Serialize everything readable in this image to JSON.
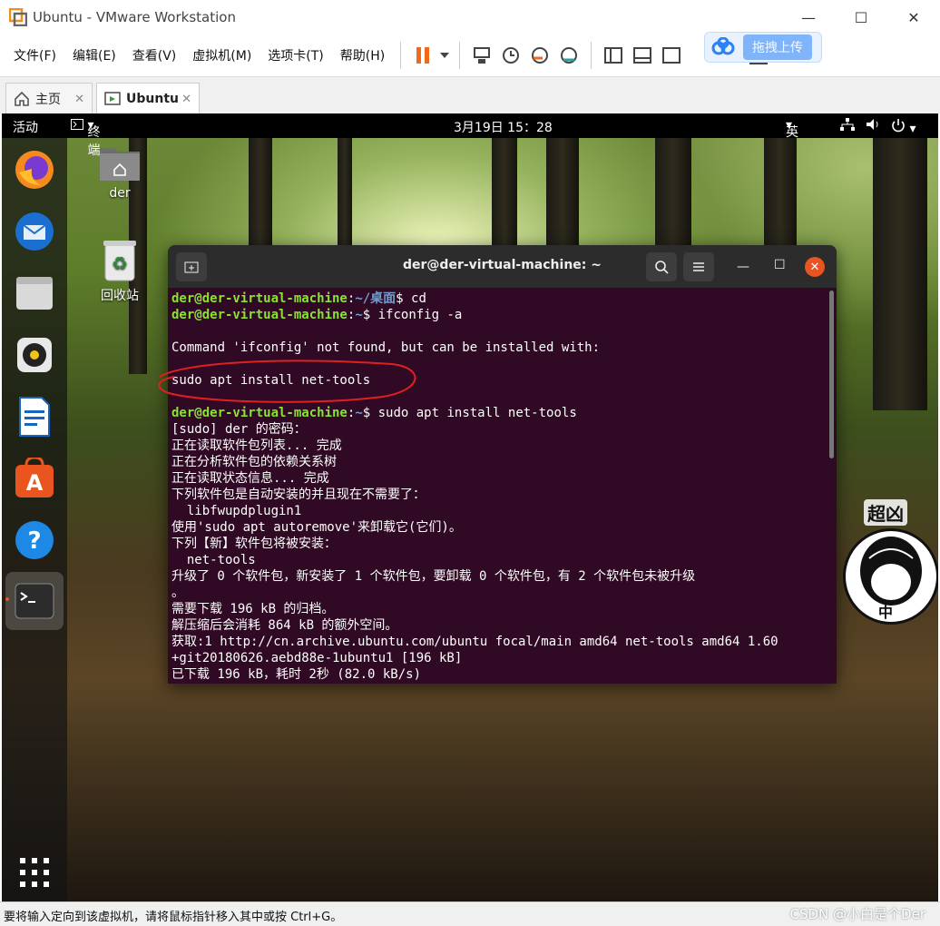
{
  "window": {
    "title": "Ubuntu - VMware Workstation"
  },
  "menu": [
    "文件(F)",
    "编辑(E)",
    "查看(V)",
    "虚拟机(M)",
    "选项卡(T)",
    "帮助(H)"
  ],
  "baidu_float": {
    "label": "拖拽上传"
  },
  "tabs": [
    {
      "label": "主页",
      "active": false
    },
    {
      "label": "Ubuntu",
      "active": true
    }
  ],
  "ubuntu_topbar": {
    "activities": "活动",
    "app_menu": "终端",
    "clock": "3月19日 15：28",
    "input_method": "英"
  },
  "desktop_icons": [
    {
      "label": "der"
    },
    {
      "label": "回收站"
    }
  ],
  "terminal": {
    "title": "der@der-virtual-machine: ~",
    "prompt_user": "der@der-virtual-machine",
    "lines": {
      "l1_path": "~/桌面",
      "l1_cmd": "$ cd",
      "l2_path": "~",
      "l2_cmd": "$ ifconfig -a",
      "l3": "",
      "l4": "Command 'ifconfig' not found, but can be installed with:",
      "l5": "",
      "l6": "sudo apt install net-tools",
      "l7": "",
      "l8_path": "~",
      "l8_cmd": "$ sudo apt install net-tools",
      "l9": "[sudo] der 的密码：",
      "l10": "正在读取软件包列表... 完成",
      "l11": "正在分析软件包的依赖关系树",
      "l12": "正在读取状态信息... 完成",
      "l13": "下列软件包是自动安装的并且现在不需要了：",
      "l14": "  libfwupdplugin1",
      "l15": "使用'sudo apt autoremove'来卸载它(它们)。",
      "l16": "下列【新】软件包将被安装：",
      "l17": "  net-tools",
      "l18": "升级了 0 个软件包，新安装了 1 个软件包，要卸载 0 个软件包，有 2 个软件包未被升级",
      "l19": "。",
      "l20": "需要下载 196 kB 的归档。",
      "l21": "解压缩后会消耗 864 kB 的额外空间。",
      "l22": "获取:1 http://cn.archive.ubuntu.com/ubuntu focal/main amd64 net-tools amd64 1.60",
      "l23": "+git20180626.aebd88e-1ubuntu1 [196 kB]",
      "l24": "已下载 196 kB，耗时 2秒 (82.0 kB/s)"
    }
  },
  "avatar_caption": "超凶",
  "avatar_text": "中",
  "statusbar": {
    "message": "要将输入定向到该虚拟机，请将鼠标指针移入其中或按 Ctrl+G。"
  },
  "watermark": "CSDN @小白是个Der",
  "colors": {
    "terminal_bg": "#300a24",
    "prompt_green": "#8ae234",
    "path_blue": "#729fcf",
    "annotation_red": "#e02020"
  }
}
